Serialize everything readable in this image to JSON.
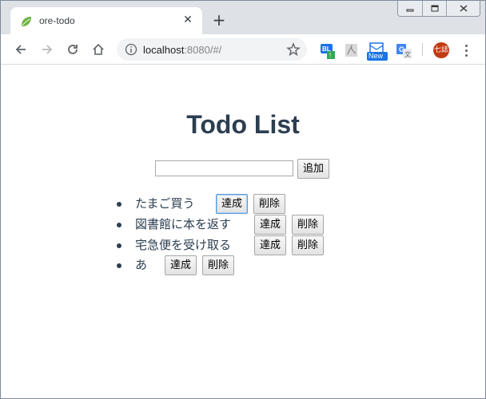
{
  "browser": {
    "tab_title": "ore-todo",
    "tab_close": "✕",
    "new_tab": "+",
    "url_host": "localhost",
    "url_rest": ":8080/#/",
    "avatar_text": "七誌",
    "extensions": [
      "bl-extension-icon",
      "pdf-extension-icon",
      "new-extension-icon",
      "translate-extension-icon"
    ],
    "extension_badge": "New"
  },
  "page": {
    "title": "Todo List",
    "input_value": "",
    "add_label": "追加",
    "complete_label": "達成",
    "delete_label": "削除",
    "todos": [
      {
        "text": "たまご買う"
      },
      {
        "text": "図書館に本を返す"
      },
      {
        "text": "宅急便を受け取る"
      },
      {
        "text": "あ"
      }
    ]
  },
  "colors": {
    "heading": "#2c3e50",
    "tabstrip": "#dee1e6",
    "avatar": "#c23a12"
  }
}
